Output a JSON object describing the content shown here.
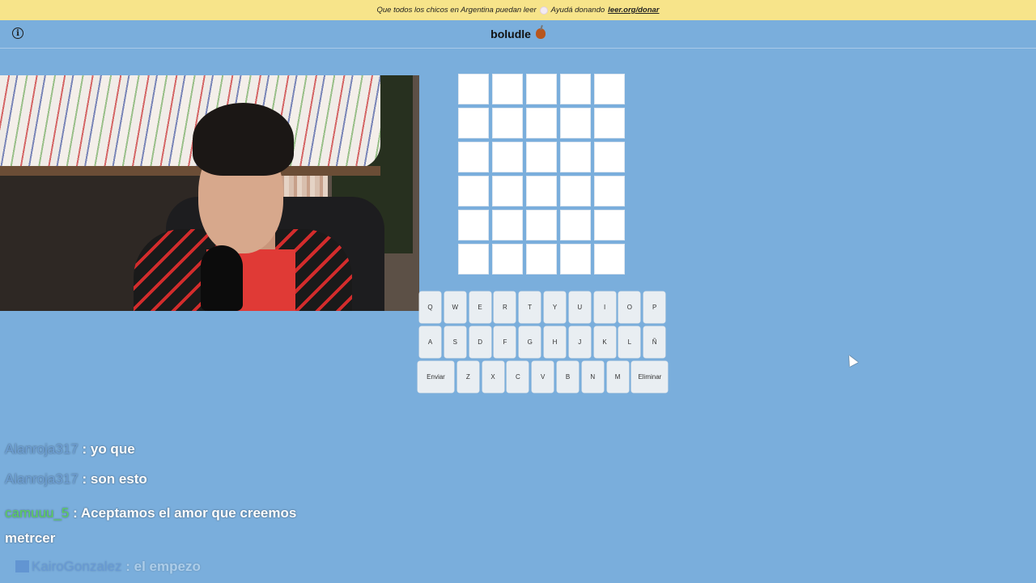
{
  "banner": {
    "text": "Que todos los chicos en Argentina puedan leer",
    "cta": "Ayudá donando",
    "link": "leer.org/donar"
  },
  "header": {
    "title": "boludle",
    "info_icon": "info-icon",
    "title_icon": "mate-icon"
  },
  "board": {
    "rows": 6,
    "cols": 5
  },
  "keyboard": {
    "row1": [
      "Q",
      "W",
      "E",
      "R",
      "T",
      "Y",
      "U",
      "I",
      "O",
      "P"
    ],
    "row2": [
      "A",
      "S",
      "D",
      "F",
      "G",
      "H",
      "J",
      "K",
      "L",
      "Ñ"
    ],
    "row3": [
      "Enviar",
      "Z",
      "X",
      "C",
      "V",
      "B",
      "N",
      "M",
      "Eliminar"
    ]
  },
  "chat": {
    "messages": [
      {
        "user": "Alanroja317",
        "text": ": yo que",
        "color": "#6fa0d6"
      },
      {
        "user": "Alanroja317",
        "text": ": son esto",
        "color": "#6fa0d6"
      },
      {
        "user": "camuuu_5",
        "text": ": Aceptamos el amor que creemos metrcer",
        "color": "#5cd35c"
      },
      {
        "user": "KairoGonzalez",
        "text": ": el empezo",
        "color": "#4a78c8"
      }
    ]
  },
  "colors": {
    "background": "#7aaedc",
    "banner": "#f7e48a",
    "tile": "#ffffff",
    "key": "#e9eef2"
  }
}
